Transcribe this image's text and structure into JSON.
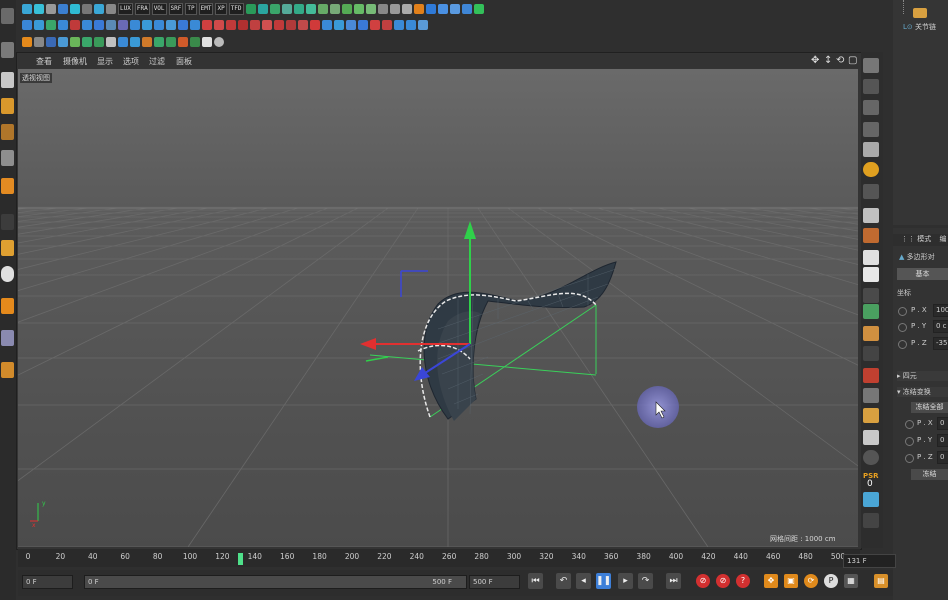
{
  "viewport": {
    "menus": [
      "查看",
      "摄像机",
      "显示",
      "选项",
      "过滤",
      "面板"
    ],
    "label": "透视视图",
    "grid_spacing": "网格间距 : 1000 cm"
  },
  "toolbar_row1_text_icons": [
    "LUX",
    "FRA",
    "VOL",
    "SRF",
    "TP",
    "EMT",
    "XP",
    "TFD"
  ],
  "object_panel": {
    "item": "关节链"
  },
  "attributes": {
    "tabs": [
      "模式",
      "编"
    ],
    "object_label": "多边形对",
    "basic_button": "基本",
    "section_coord": "坐标",
    "px_label": "P . X",
    "px_value": "100",
    "py_label": "P . Y",
    "py_value": "0 c",
    "pz_label": "P . Z",
    "pz_value": "-35",
    "section_quat": "四元",
    "section_freeze": "冻结变换",
    "freeze_button": "冻结全部",
    "fx_label": "P . X",
    "fx_value": "0",
    "fy_label": "P . Y",
    "fy_value": "0",
    "fz_label": "P . Z",
    "fz_value": "0",
    "freeze_btn2": "冻结"
  },
  "timeline": {
    "ticks": [
      "0",
      "20",
      "40",
      "60",
      "80",
      "100",
      "120",
      "140",
      "160",
      "180",
      "200",
      "220",
      "240",
      "260",
      "280",
      "300",
      "320",
      "340",
      "360",
      "380",
      "400",
      "420",
      "440",
      "460",
      "480",
      "500"
    ],
    "current_frame": "131 F",
    "playhead_value": 131
  },
  "transport": {
    "start_field": "0 F",
    "range_start": "0 F",
    "range_end": "500 F",
    "end_field": "500 F"
  },
  "right_column": {
    "psr_label": "PSR",
    "psr_value": "0"
  },
  "colors": {
    "background": "#2f2f2f",
    "viewport_top": "#6a6a6a",
    "axis_y": "#2fd04a",
    "axis_x": "#e23030",
    "axis_z": "#3a46d8",
    "playhead": "#4fe08a"
  }
}
